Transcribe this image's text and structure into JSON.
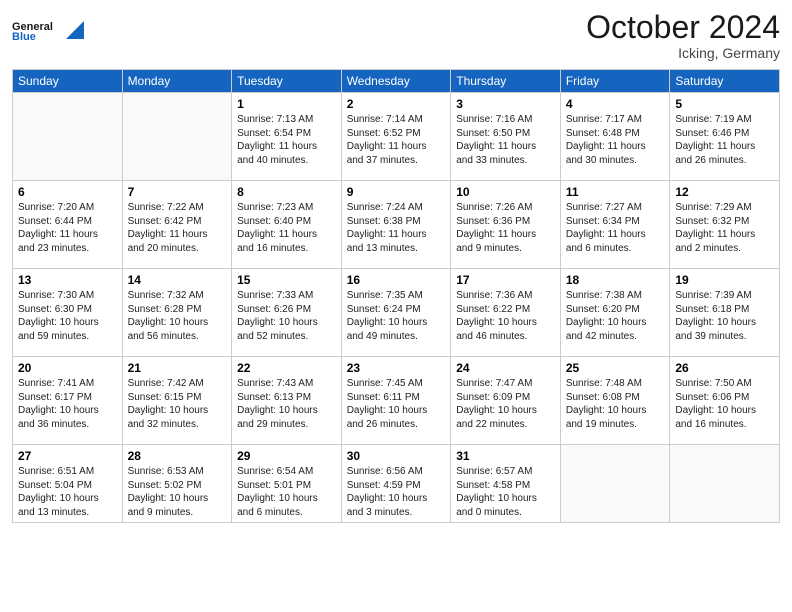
{
  "header": {
    "logo_general": "General",
    "logo_blue": "Blue",
    "month_title": "October 2024",
    "location": "Icking, Germany"
  },
  "weekdays": [
    "Sunday",
    "Monday",
    "Tuesday",
    "Wednesday",
    "Thursday",
    "Friday",
    "Saturday"
  ],
  "rows": [
    [
      {
        "day": "",
        "info": ""
      },
      {
        "day": "",
        "info": ""
      },
      {
        "day": "1",
        "info": "Sunrise: 7:13 AM\nSunset: 6:54 PM\nDaylight: 11 hours and 40 minutes."
      },
      {
        "day": "2",
        "info": "Sunrise: 7:14 AM\nSunset: 6:52 PM\nDaylight: 11 hours and 37 minutes."
      },
      {
        "day": "3",
        "info": "Sunrise: 7:16 AM\nSunset: 6:50 PM\nDaylight: 11 hours and 33 minutes."
      },
      {
        "day": "4",
        "info": "Sunrise: 7:17 AM\nSunset: 6:48 PM\nDaylight: 11 hours and 30 minutes."
      },
      {
        "day": "5",
        "info": "Sunrise: 7:19 AM\nSunset: 6:46 PM\nDaylight: 11 hours and 26 minutes."
      }
    ],
    [
      {
        "day": "6",
        "info": "Sunrise: 7:20 AM\nSunset: 6:44 PM\nDaylight: 11 hours and 23 minutes."
      },
      {
        "day": "7",
        "info": "Sunrise: 7:22 AM\nSunset: 6:42 PM\nDaylight: 11 hours and 20 minutes."
      },
      {
        "day": "8",
        "info": "Sunrise: 7:23 AM\nSunset: 6:40 PM\nDaylight: 11 hours and 16 minutes."
      },
      {
        "day": "9",
        "info": "Sunrise: 7:24 AM\nSunset: 6:38 PM\nDaylight: 11 hours and 13 minutes."
      },
      {
        "day": "10",
        "info": "Sunrise: 7:26 AM\nSunset: 6:36 PM\nDaylight: 11 hours and 9 minutes."
      },
      {
        "day": "11",
        "info": "Sunrise: 7:27 AM\nSunset: 6:34 PM\nDaylight: 11 hours and 6 minutes."
      },
      {
        "day": "12",
        "info": "Sunrise: 7:29 AM\nSunset: 6:32 PM\nDaylight: 11 hours and 2 minutes."
      }
    ],
    [
      {
        "day": "13",
        "info": "Sunrise: 7:30 AM\nSunset: 6:30 PM\nDaylight: 10 hours and 59 minutes."
      },
      {
        "day": "14",
        "info": "Sunrise: 7:32 AM\nSunset: 6:28 PM\nDaylight: 10 hours and 56 minutes."
      },
      {
        "day": "15",
        "info": "Sunrise: 7:33 AM\nSunset: 6:26 PM\nDaylight: 10 hours and 52 minutes."
      },
      {
        "day": "16",
        "info": "Sunrise: 7:35 AM\nSunset: 6:24 PM\nDaylight: 10 hours and 49 minutes."
      },
      {
        "day": "17",
        "info": "Sunrise: 7:36 AM\nSunset: 6:22 PM\nDaylight: 10 hours and 46 minutes."
      },
      {
        "day": "18",
        "info": "Sunrise: 7:38 AM\nSunset: 6:20 PM\nDaylight: 10 hours and 42 minutes."
      },
      {
        "day": "19",
        "info": "Sunrise: 7:39 AM\nSunset: 6:18 PM\nDaylight: 10 hours and 39 minutes."
      }
    ],
    [
      {
        "day": "20",
        "info": "Sunrise: 7:41 AM\nSunset: 6:17 PM\nDaylight: 10 hours and 36 minutes."
      },
      {
        "day": "21",
        "info": "Sunrise: 7:42 AM\nSunset: 6:15 PM\nDaylight: 10 hours and 32 minutes."
      },
      {
        "day": "22",
        "info": "Sunrise: 7:43 AM\nSunset: 6:13 PM\nDaylight: 10 hours and 29 minutes."
      },
      {
        "day": "23",
        "info": "Sunrise: 7:45 AM\nSunset: 6:11 PM\nDaylight: 10 hours and 26 minutes."
      },
      {
        "day": "24",
        "info": "Sunrise: 7:47 AM\nSunset: 6:09 PM\nDaylight: 10 hours and 22 minutes."
      },
      {
        "day": "25",
        "info": "Sunrise: 7:48 AM\nSunset: 6:08 PM\nDaylight: 10 hours and 19 minutes."
      },
      {
        "day": "26",
        "info": "Sunrise: 7:50 AM\nSunset: 6:06 PM\nDaylight: 10 hours and 16 minutes."
      }
    ],
    [
      {
        "day": "27",
        "info": "Sunrise: 6:51 AM\nSunset: 5:04 PM\nDaylight: 10 hours and 13 minutes."
      },
      {
        "day": "28",
        "info": "Sunrise: 6:53 AM\nSunset: 5:02 PM\nDaylight: 10 hours and 9 minutes."
      },
      {
        "day": "29",
        "info": "Sunrise: 6:54 AM\nSunset: 5:01 PM\nDaylight: 10 hours and 6 minutes."
      },
      {
        "day": "30",
        "info": "Sunrise: 6:56 AM\nSunset: 4:59 PM\nDaylight: 10 hours and 3 minutes."
      },
      {
        "day": "31",
        "info": "Sunrise: 6:57 AM\nSunset: 4:58 PM\nDaylight: 10 hours and 0 minutes."
      },
      {
        "day": "",
        "info": ""
      },
      {
        "day": "",
        "info": ""
      }
    ]
  ]
}
